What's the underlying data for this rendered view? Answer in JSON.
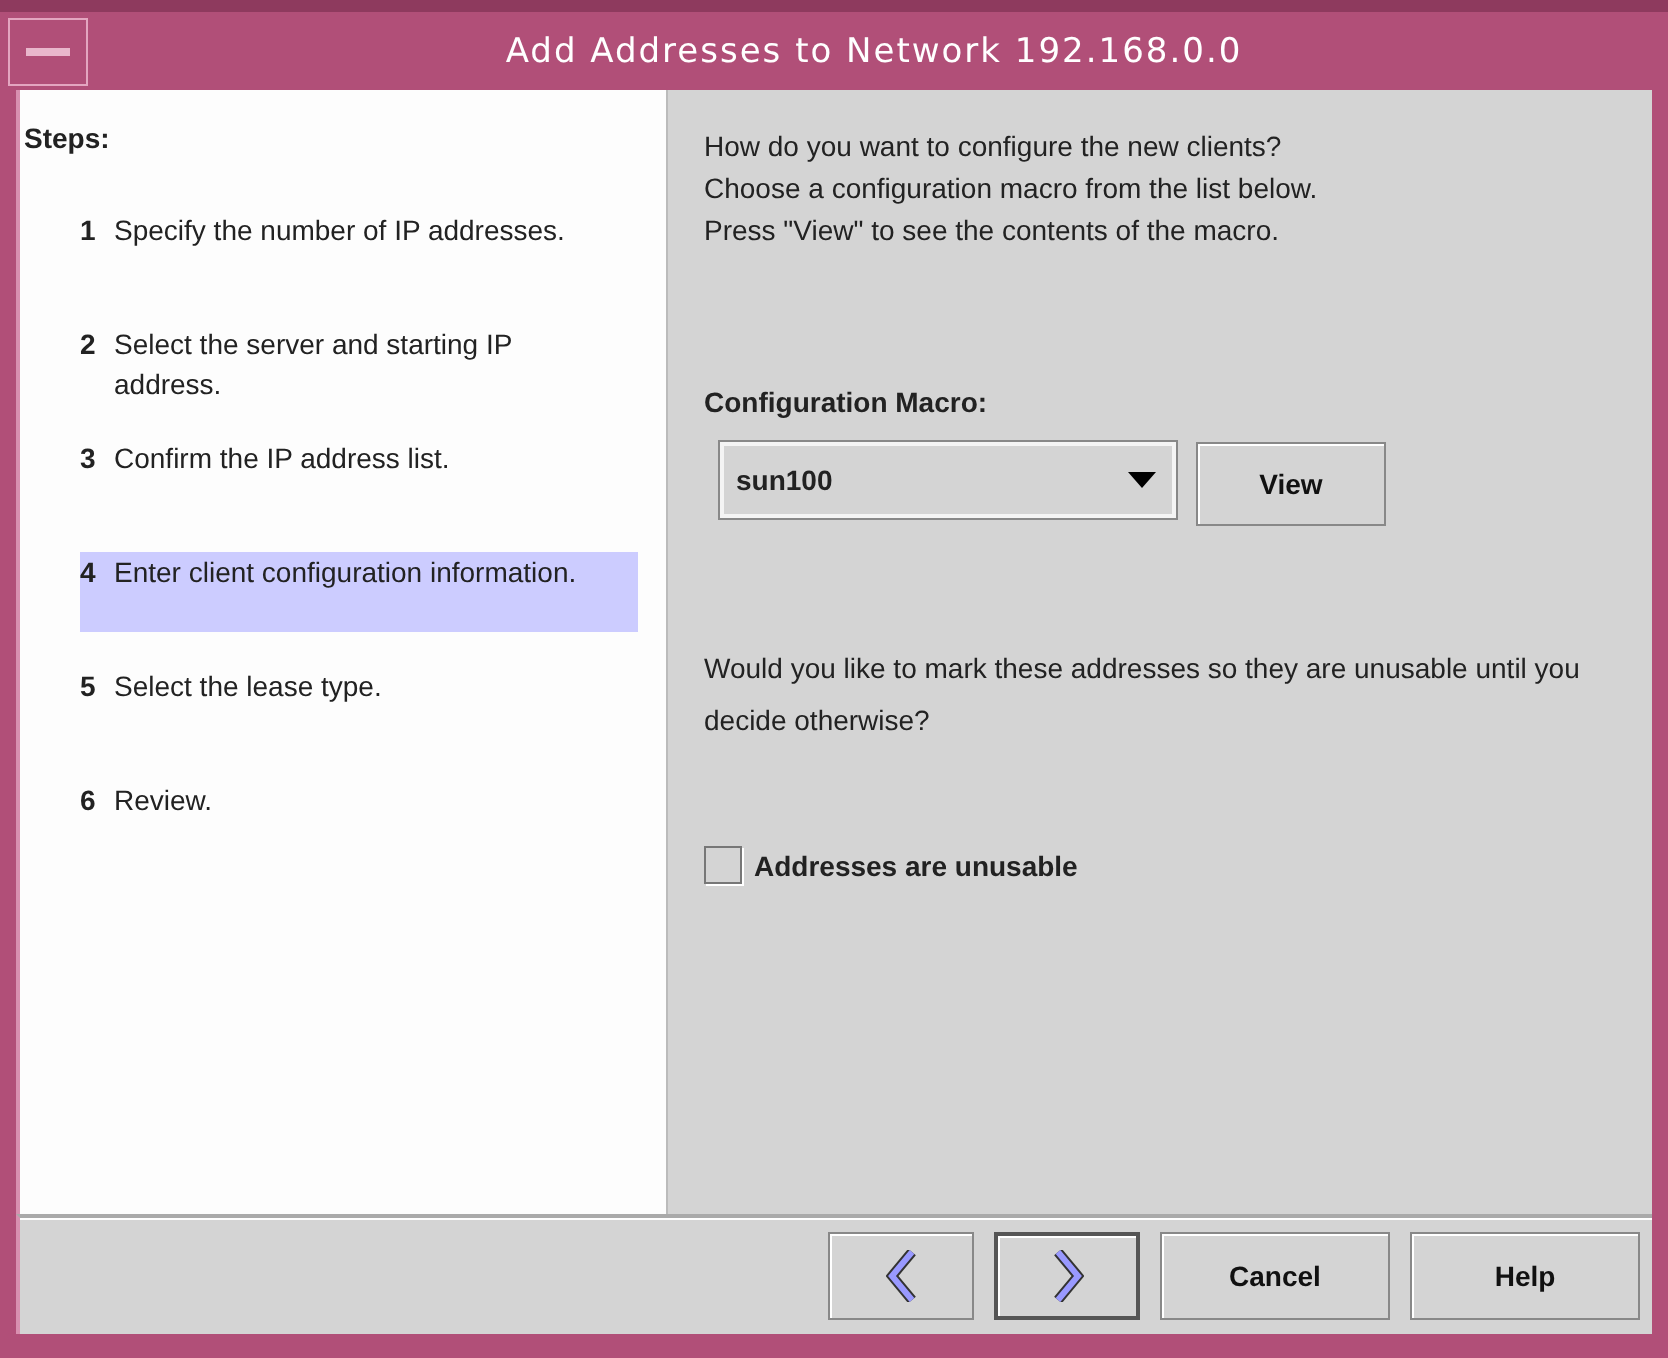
{
  "window": {
    "title": "Add Addresses to Network 192.168.0.0"
  },
  "steps": {
    "heading": "Steps:",
    "items": [
      {
        "number": "1",
        "text": "Specify the number of IP addresses.",
        "selected": false
      },
      {
        "number": "2",
        "text": "Select the server and starting IP address.",
        "selected": false
      },
      {
        "number": "3",
        "text": "Confirm the IP address list.",
        "selected": false
      },
      {
        "number": "4",
        "text": "Enter client configuration information.",
        "selected": true
      },
      {
        "number": "5",
        "text": "Select the lease type.",
        "selected": false
      },
      {
        "number": "6",
        "text": "Review.",
        "selected": false
      }
    ]
  },
  "content": {
    "intro_lines": [
      "How do you want to configure the new clients?",
      "Choose a configuration macro from the list below.",
      "Press \"View\" to see the contents of the macro."
    ],
    "macro_label": "Configuration Macro:",
    "macro_value": "sun100",
    "view_button": "View",
    "question": "Would you like to mark these addresses so they are unusable until you decide otherwise?",
    "checkbox": {
      "label": "Addresses are unusable",
      "checked": false
    }
  },
  "buttons": [
    {
      "kind": "back"
    },
    {
      "kind": "next"
    },
    {
      "kind": "text",
      "label": "Cancel"
    },
    {
      "kind": "text",
      "label": "Help"
    }
  ]
}
